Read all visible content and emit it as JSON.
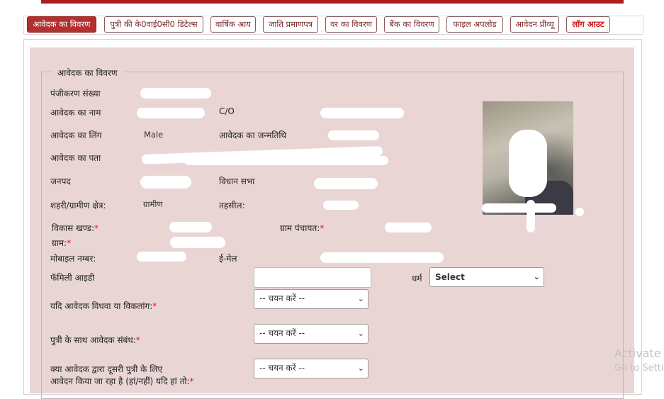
{
  "tabs": [
    {
      "label": "आवेदक का विवरण",
      "active": true
    },
    {
      "label": "पुत्री की के0वाई0सी0 डिटेल्स"
    },
    {
      "label": "वार्षिक आय"
    },
    {
      "label": "जाति प्रमाणपत्र"
    },
    {
      "label": "वर का विवरण"
    },
    {
      "label": "बैंक का विवरण"
    },
    {
      "label": "फाइल अपलोड"
    },
    {
      "label": "आवेदन प्रीव्यू"
    },
    {
      "label": "लॉग आउट",
      "logout": true
    }
  ],
  "section": {
    "legend": "आवेदक का विवरण"
  },
  "fields": {
    "registration_no": {
      "label": "पंजीकरण संख्या"
    },
    "applicant_name": {
      "label": "आवेदक का नाम"
    },
    "care_of": {
      "label": "C/O"
    },
    "gender": {
      "label": "आवेदक का लिंग",
      "value": "Male"
    },
    "dob": {
      "label": "आवेदक का जन्मतिथि"
    },
    "address": {
      "label": "आवेदक का पता"
    },
    "district": {
      "label": "जनपद"
    },
    "assembly": {
      "label": "विधान सभा"
    },
    "area_type": {
      "label": "शहरी/ग्रामीण क्षेत्र:",
      "value": "ग्रामीण"
    },
    "tehsil": {
      "label": "तहसील:"
    },
    "block": {
      "label": "विकास खण्ड:",
      "required": "*"
    },
    "gram_panchayat": {
      "label": "ग्राम पंचायत:",
      "required": "*"
    },
    "village": {
      "label": "ग्राम:",
      "required": "*"
    },
    "mobile": {
      "label": "मोबाइल नम्बर:"
    },
    "email": {
      "label": "ई-मेल"
    },
    "family_id": {
      "label": "फॅमिली आइडी",
      "value": ""
    },
    "religion": {
      "label": "धर्म",
      "selected": "Select"
    },
    "widow_disabled": {
      "label": "यदि आवेदक विधवा या विकलांग:",
      "required": "*",
      "selected": "-- चयन करें --"
    },
    "relation": {
      "label": "पुत्री के साथ आवेदक संबंध:",
      "required": "*",
      "selected": "-- चयन करें --"
    },
    "other_daughter": {
      "label_line1": "क्या आवेदक द्वारा दूसरी पुत्री के लिए",
      "label_line2": "आवेदन किया जा रहा है (हां/नहीं) यदि हां तो:",
      "required": "*",
      "selected": "-- चयन करें --"
    }
  },
  "watermark": {
    "line1": "Activate",
    "line2": "Go to Setti"
  }
}
